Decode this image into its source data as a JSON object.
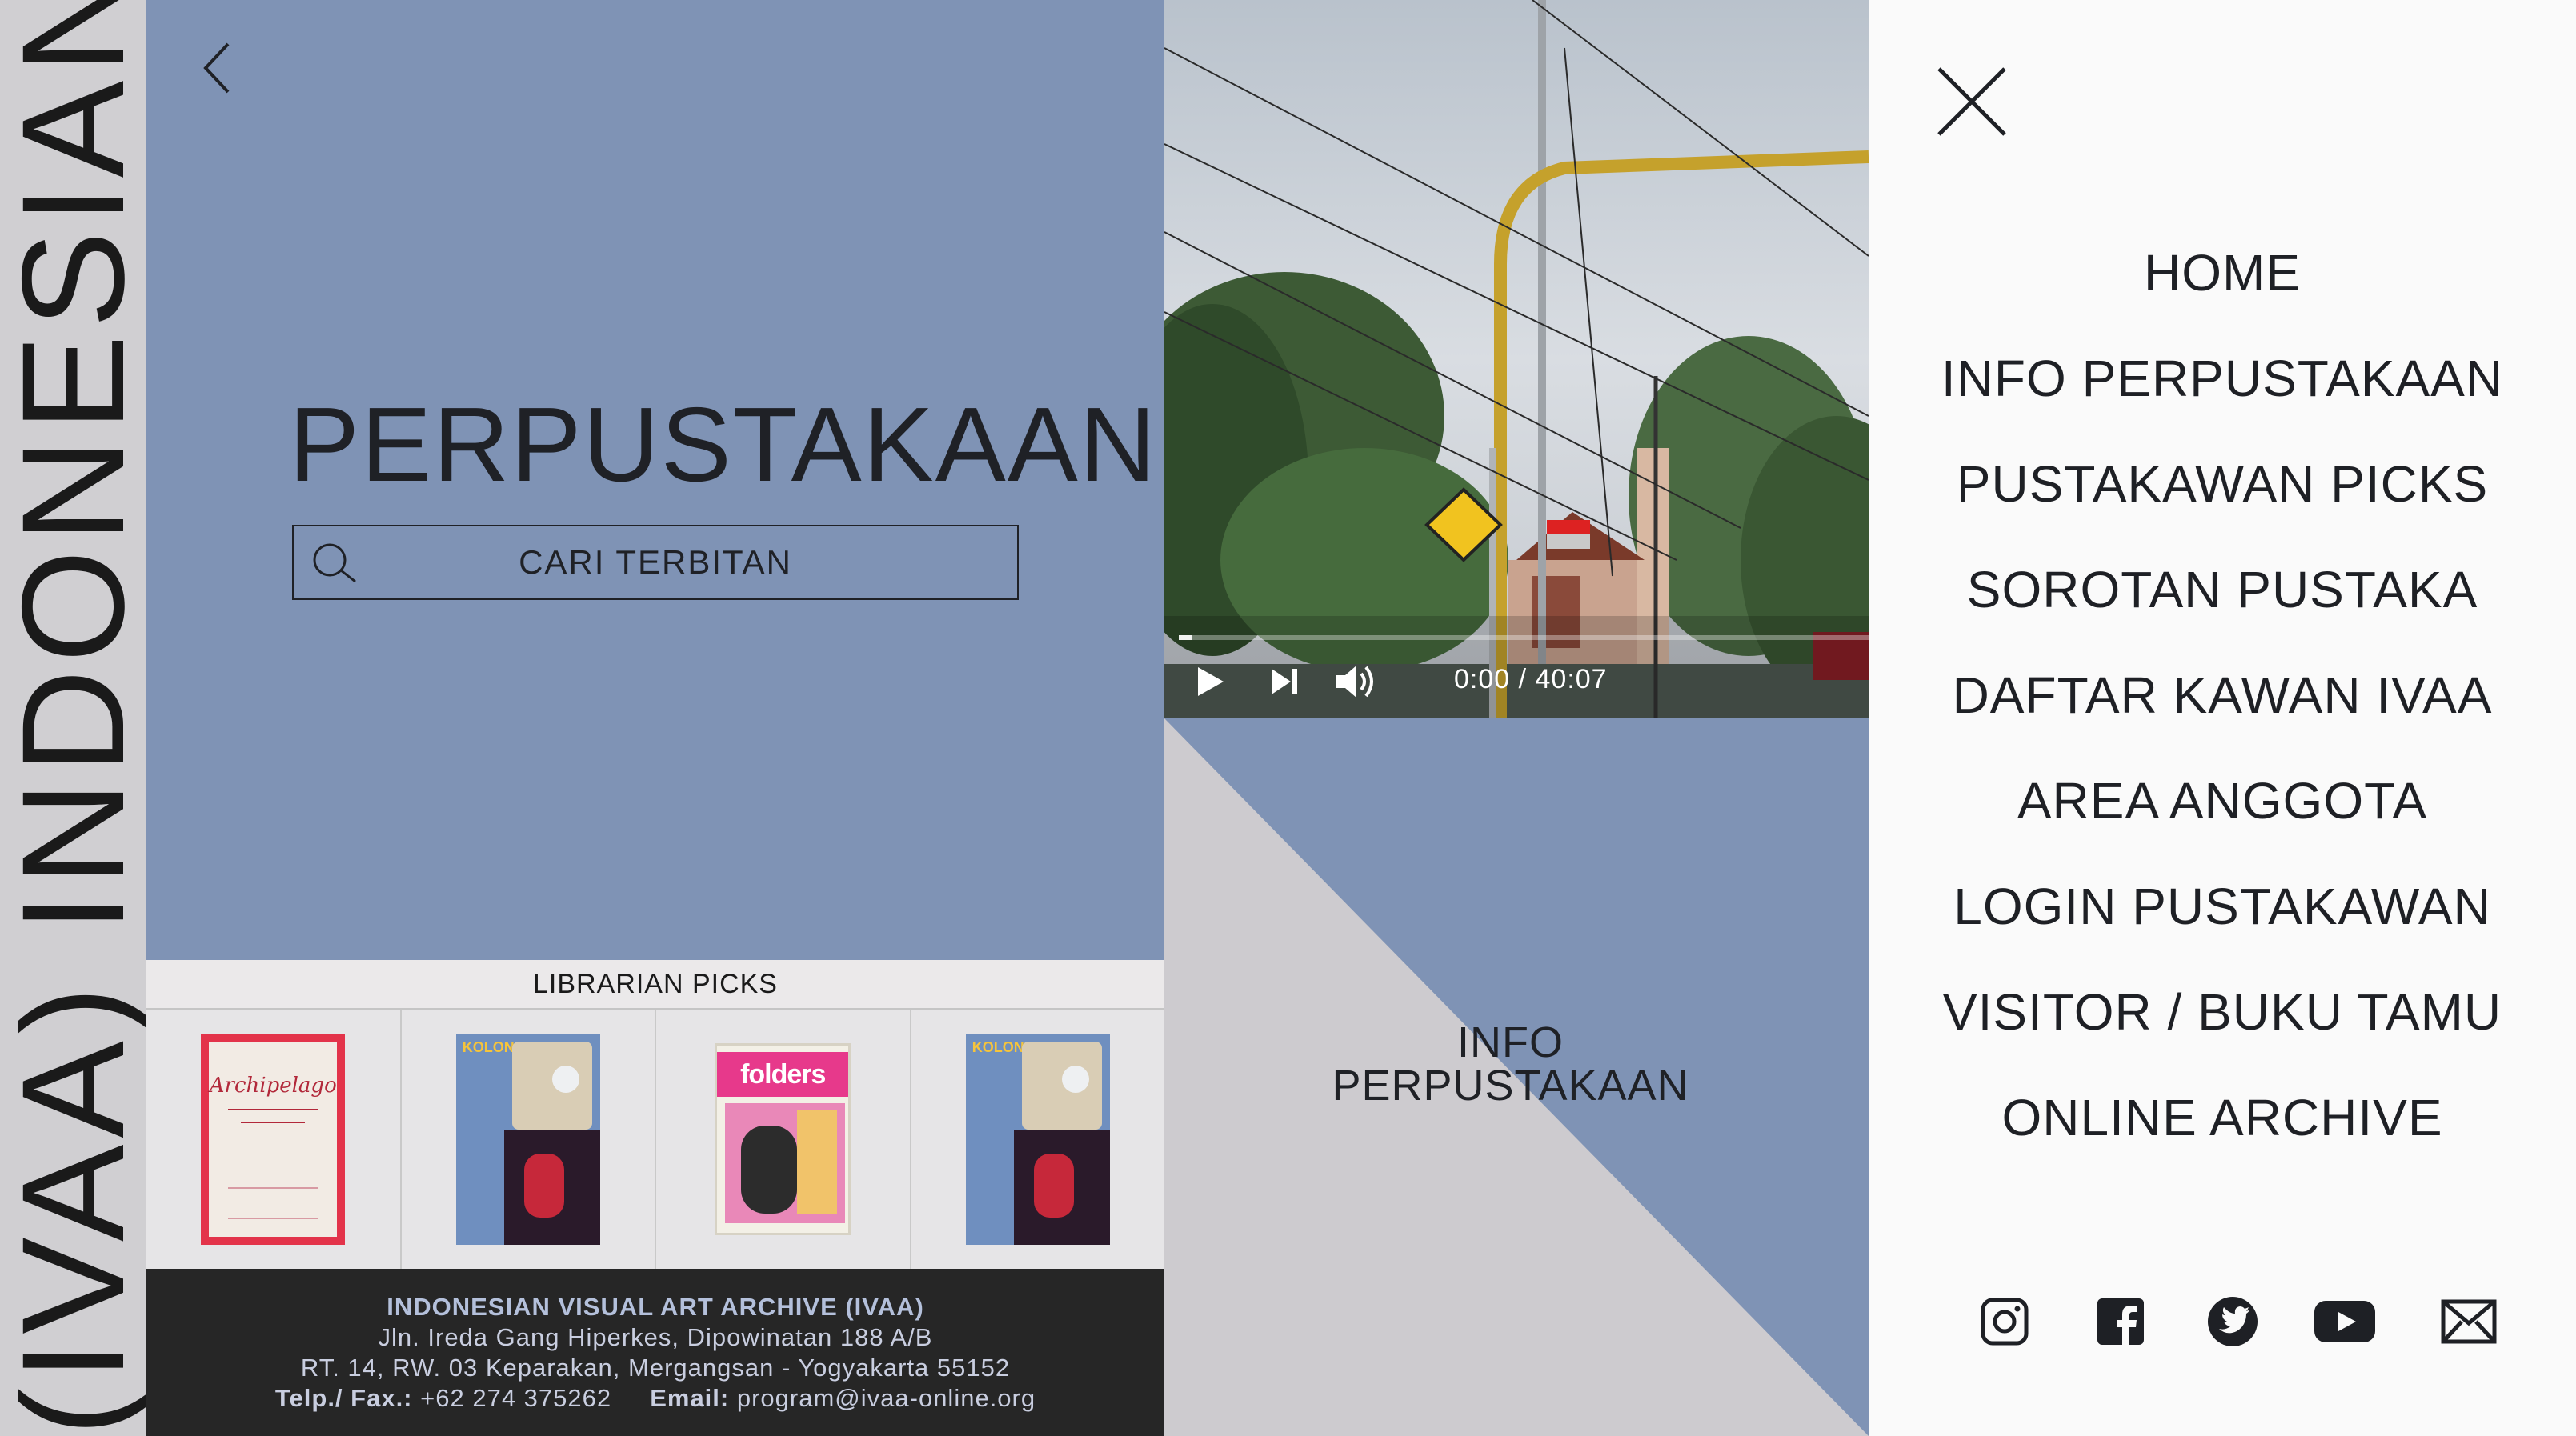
{
  "brand": {
    "vertical_text": "(IVAA) INDONESIAN VISU"
  },
  "hero": {
    "title": "PERPUSTAKAAN",
    "search_label": "CARI TERBITAN"
  },
  "picks": {
    "header": "LIBRARIAN PICKS",
    "items": [
      {
        "cover_title": "Archipelago",
        "icon": "book-cover-archipelago"
      },
      {
        "cover_title": "KOLONG SINEMA",
        "icon": "book-cover-kolong-sinema"
      },
      {
        "cover_title": "folders",
        "icon": "book-cover-folders"
      },
      {
        "cover_title": "KOLONG SINEMA",
        "icon": "book-cover-kolong-sinema"
      }
    ]
  },
  "footer": {
    "org": "INDONESIAN VISUAL ART ARCHIVE (IVAA)",
    "address1": "Jln. Ireda Gang Hiperkes, Dipowinatan 188 A/B",
    "address2": "RT. 14, RW. 03 Keparakan, Mergangsan - Yogyakarta 55152",
    "phone_label": "Telp./ Fax.:",
    "phone": "+62 274 375262",
    "email_label": "Email:",
    "email": "program@ivaa-online.org"
  },
  "video": {
    "time": "0:00 / 40:07",
    "progress": 0.02,
    "controls": [
      "play-icon",
      "next-icon",
      "volume-icon"
    ]
  },
  "info": {
    "line1": "INFO",
    "line2": "PERPUSTAKAAN"
  },
  "menu": {
    "items": [
      "HOME",
      "INFO PERPUSTAKAAN",
      "PUSTAKAWAN PICKS",
      "SOROTAN PUSTAKA",
      "DAFTAR KAWAN IVAA",
      "AREA ANGGOTA",
      "LOGIN PUSTAKAWAN",
      "VISITOR / BUKU TAMU",
      "ONLINE ARCHIVE"
    ],
    "social": [
      "instagram-icon",
      "facebook-icon",
      "twitter-icon",
      "youtube-icon",
      "mail-icon"
    ]
  },
  "colors": {
    "hero_blue": "#7f93b5",
    "grey": "#cdcbcf",
    "footer_dark": "#262626",
    "text_dark": "#1f2126"
  }
}
